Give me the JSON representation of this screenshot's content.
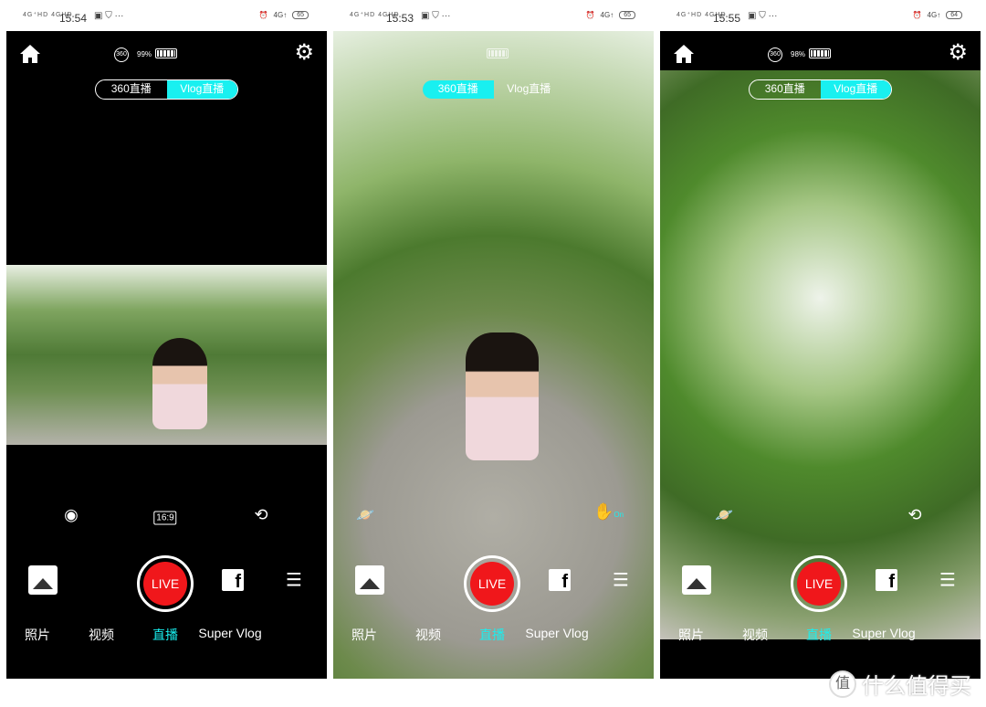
{
  "panels": [
    {
      "status": {
        "signal": "4G⁺HD 4GHD",
        "time": "15:54",
        "icons": "▣ ⛉ ···",
        "alarm": "⏰",
        "network": "4G↑",
        "battery": "65"
      },
      "camera_battery": "99%",
      "tabs": [
        "360直播",
        "Vlog直播"
      ],
      "active_tab": 1,
      "tools": {
        "lens": "◉",
        "ratio": "16:9",
        "flip": "⟲"
      },
      "modes": [
        "照片",
        "视频",
        "直播",
        "Super Vlog"
      ],
      "active_mode": 2,
      "live_label": "LIVE",
      "facebook": "f",
      "settings_icon": "⚙",
      "sliders_icon": "☰"
    },
    {
      "status": {
        "signal": "4G⁺HD 4GHD",
        "time": "15:53",
        "icons": "▣ ⛉ ···",
        "alarm": "⏰",
        "network": "4G↑",
        "battery": "65"
      },
      "camera_battery": "",
      "tabs": [
        "360直播",
        "Vlog直播"
      ],
      "active_tab": 0,
      "tools": {
        "planet": "🪐",
        "gesture": "✋",
        "gesture_state": "On"
      },
      "modes": [
        "照片",
        "视频",
        "直播",
        "Super Vlog"
      ],
      "active_mode": 2,
      "live_label": "LIVE",
      "facebook": "f",
      "sliders_icon": "☰"
    },
    {
      "status": {
        "signal": "4G⁺HD 4GHD",
        "time": "15:55",
        "icons": "▣ ⛉ ···",
        "alarm": "⏰",
        "network": "4G↑",
        "battery": "64"
      },
      "camera_battery": "98%",
      "tabs": [
        "360直播",
        "Vlog直播"
      ],
      "active_tab": 1,
      "tools": {
        "planet": "🪐",
        "flip": "⟲"
      },
      "modes": [
        "照片",
        "视频",
        "直播",
        "Super Vlog"
      ],
      "active_mode": 2,
      "live_label": "LIVE",
      "facebook": "f",
      "settings_icon": "⚙",
      "sliders_icon": "☰"
    }
  ],
  "watermark": {
    "badge": "值",
    "text": "什么值得买"
  },
  "colors": {
    "accent": "#19f0f0",
    "live": "#f0171b"
  }
}
